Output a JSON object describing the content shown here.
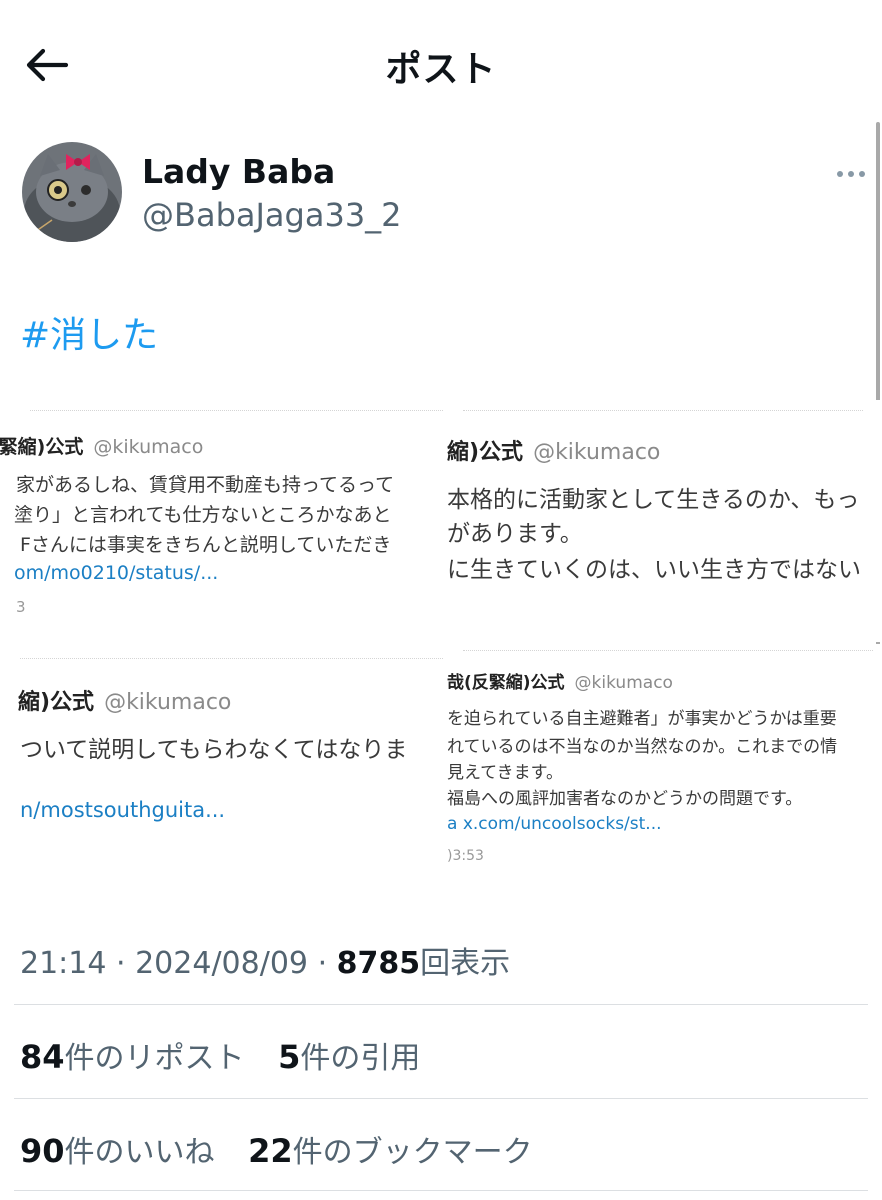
{
  "header": {
    "title": "ポスト"
  },
  "author": {
    "display_name": "Lady Baba",
    "handle": "@BabaJaga33_2"
  },
  "post": {
    "hashtag": "#消した",
    "embedded": [
      {
        "name": ")緊縮)公式",
        "handle": "@kikumaco",
        "lines": [
          "家があるしね、賃貸用不動産も持ってるって",
          "塗り」と言われても仕方ないところかなあと",
          "Fさんには事実をきちんと説明していただき"
        ],
        "link": "om/mo0210/status/...",
        "time": "3"
      },
      {
        "name": "縮)公式",
        "handle": "@kikumaco",
        "lines": [
          "本格的に活動家として生きるのか、もっ",
          "があります。",
          "に生きていくのは、いい生き方ではない"
        ]
      },
      {
        "name": "縮)公式",
        "handle": "@kikumaco",
        "lines": [
          "ついて説明してもらわなくてはなりま"
        ],
        "link": "n/mostsouthguita..."
      },
      {
        "name": "哉(反緊縮)公式",
        "handle": "@kikumaco",
        "lines": [
          "を迫られている自主避難者」が事実かどうかは重要",
          "れているのは不当なのか当然なのか。これまでの情",
          "見えてきます。",
          "福島への風評加害者なのかどうかの問題です。"
        ],
        "link": "a x.com/uncoolsocks/st...",
        "time": ")3:53"
      }
    ]
  },
  "meta": {
    "time": "21:14",
    "date": "2024/08/09",
    "views": "8785",
    "views_label": "回表示"
  },
  "stats": {
    "reposts": "84",
    "reposts_label": "件のリポスト",
    "quotes": "5",
    "quotes_label": "件の引用",
    "likes": "90",
    "likes_label": "件のいいね",
    "bookmarks": "22",
    "bookmarks_label": "件のブックマーク"
  }
}
